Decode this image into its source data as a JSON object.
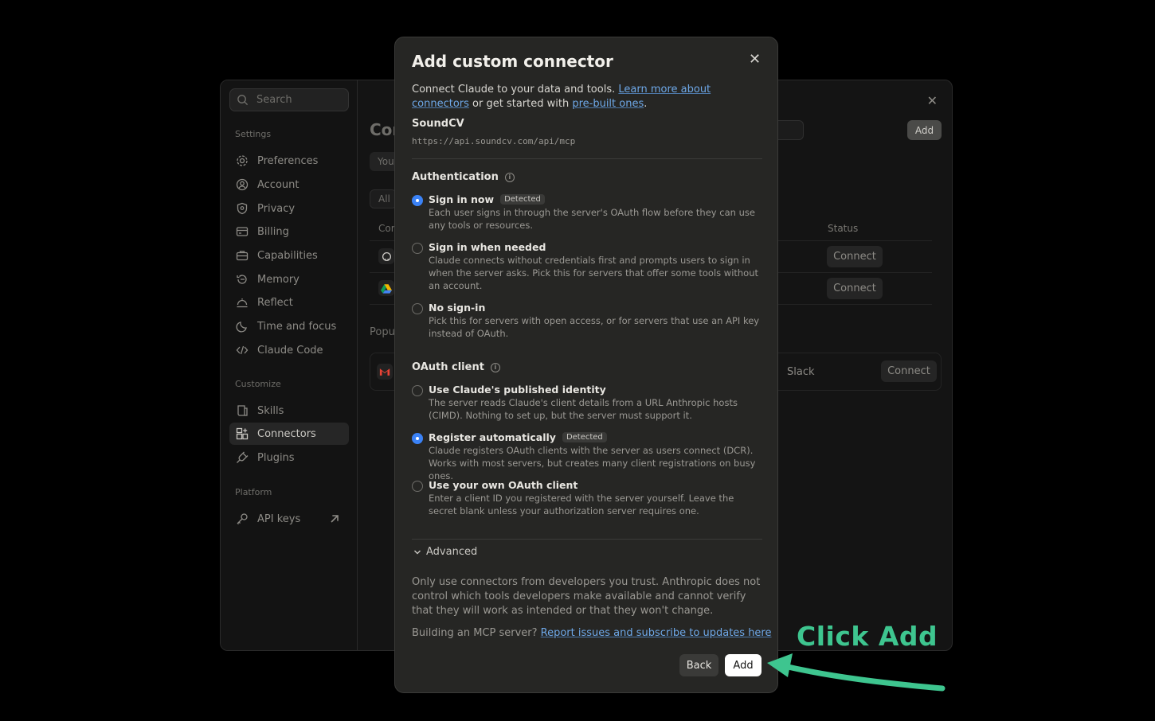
{
  "sidebar": {
    "search_placeholder": "Search",
    "sections": {
      "settings": "Settings",
      "customize": "Customize",
      "platform": "Platform"
    },
    "items": [
      {
        "label": "Preferences",
        "icon": "gear-icon"
      },
      {
        "label": "Account",
        "icon": "user-circle-icon"
      },
      {
        "label": "Privacy",
        "icon": "shield-icon"
      },
      {
        "label": "Billing",
        "icon": "card-icon"
      },
      {
        "label": "Capabilities",
        "icon": "briefcase-icon"
      },
      {
        "label": "Memory",
        "icon": "memory-icon"
      },
      {
        "label": "Reflect",
        "icon": "reflect-icon"
      },
      {
        "label": "Time and focus",
        "icon": "moon-icon"
      },
      {
        "label": "Claude Code",
        "icon": "code-icon"
      },
      {
        "label": "Skills",
        "icon": "skills-icon"
      },
      {
        "label": "Connectors",
        "icon": "connectors-icon",
        "active": true
      },
      {
        "label": "Plugins",
        "icon": "plug-icon"
      },
      {
        "label": "API keys",
        "icon": "key-icon"
      }
    ]
  },
  "background": {
    "title_partial": "Cor",
    "tab_partial": "You",
    "filter_partial": "All",
    "column_partial": "Cor",
    "popular_partial": "Popu",
    "add_button": "Add",
    "status_header": "Status",
    "connect_label": "Connect",
    "slack_label": "Slack",
    "close_glyph": "✕"
  },
  "modal": {
    "title": "Add custom connector",
    "close_glyph": "✕",
    "intro_text": "Connect Claude to your data and tools. ",
    "intro_link_1": "Learn more about connectors",
    "intro_mid": " or get started with ",
    "intro_link_2": "pre-built ones",
    "intro_end": ".",
    "connector_name": "SoundCV",
    "connector_url": "https://api.soundcv.com/api/mcp",
    "authentication": {
      "heading": "Authentication",
      "options": [
        {
          "label": "Sign in now",
          "badge": "Detected",
          "checked": true,
          "desc": "Each user signs in through the server's OAuth flow before they can use any tools or resources."
        },
        {
          "label": "Sign in when needed",
          "checked": false,
          "desc": "Claude connects without credentials first and prompts users to sign in when the server asks. Pick this for servers that offer some tools without an account."
        },
        {
          "label": "No sign-in",
          "checked": false,
          "desc": "Pick this for servers with open access, or for servers that use an API key instead of OAuth."
        }
      ]
    },
    "oauth": {
      "heading": "OAuth client",
      "options": [
        {
          "label": "Use Claude's published identity",
          "checked": false,
          "desc": "The server reads Claude's client details from a URL Anthropic hosts (CIMD). Nothing to set up, but the server must support it."
        },
        {
          "label": "Register automatically",
          "badge": "Detected",
          "checked": true,
          "desc": "Claude registers OAuth clients with the server as users connect (DCR). Works with most servers, but creates many client registrations on busy ones."
        },
        {
          "label": "Use your own OAuth client",
          "checked": false,
          "desc": "Enter a client ID you registered with the server yourself. Leave the secret blank unless your authorization server requires one."
        }
      ]
    },
    "advanced_label": "Advanced",
    "warning": "Only use connectors from developers you trust. Anthropic does not control which tools developers make available and cannot verify that they will work as intended or that they won't change.",
    "mcp_prefix": "Building an MCP server? ",
    "mcp_link": "Report issues and subscribe to updates here",
    "back_button": "Back",
    "add_button": "Add"
  },
  "annotation": {
    "text": "Click Add",
    "color": "#3ec58f"
  },
  "colors": {
    "accent_blue": "#3b82f6",
    "link_blue": "#6ea8e8",
    "modal_bg": "#262624"
  }
}
